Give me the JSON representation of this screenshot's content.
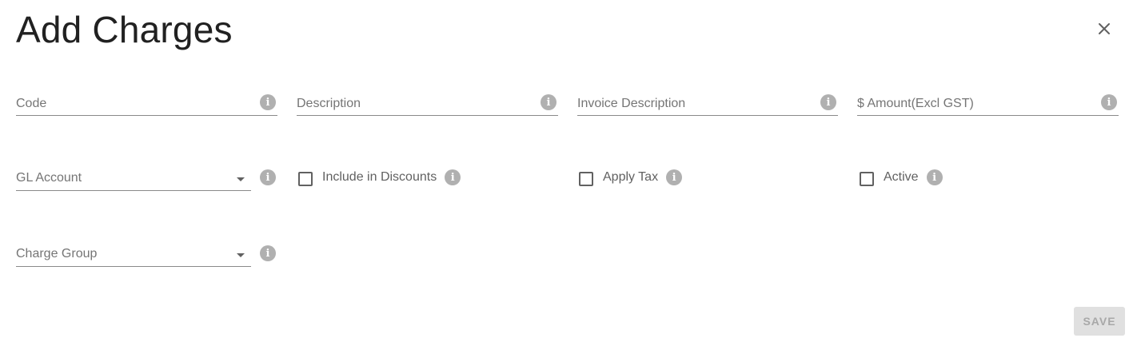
{
  "dialog": {
    "title": "Add Charges",
    "close_icon": "close-icon"
  },
  "fields": {
    "code": {
      "placeholder": "Code"
    },
    "description": {
      "placeholder": "Description"
    },
    "invoice_description": {
      "placeholder": "Invoice Description"
    },
    "amount": {
      "placeholder": "$ Amount(Excl GST)"
    }
  },
  "selects": {
    "gl_account": {
      "label": "GL Account"
    },
    "charge_group": {
      "label": "Charge Group"
    }
  },
  "checkboxes": {
    "include_in_discounts": {
      "label": "Include in Discounts",
      "checked": false
    },
    "apply_tax": {
      "label": "Apply Tax",
      "checked": false
    },
    "active": {
      "label": "Active",
      "checked": false
    }
  },
  "info_glyph": "i",
  "actions": {
    "save_label": "SAVE"
  },
  "colors": {
    "info_icon": "#b0b0b0",
    "underline": "#8a8a8a",
    "save_bg": "#e0e0e0",
    "save_text": "#a8a8a8"
  }
}
